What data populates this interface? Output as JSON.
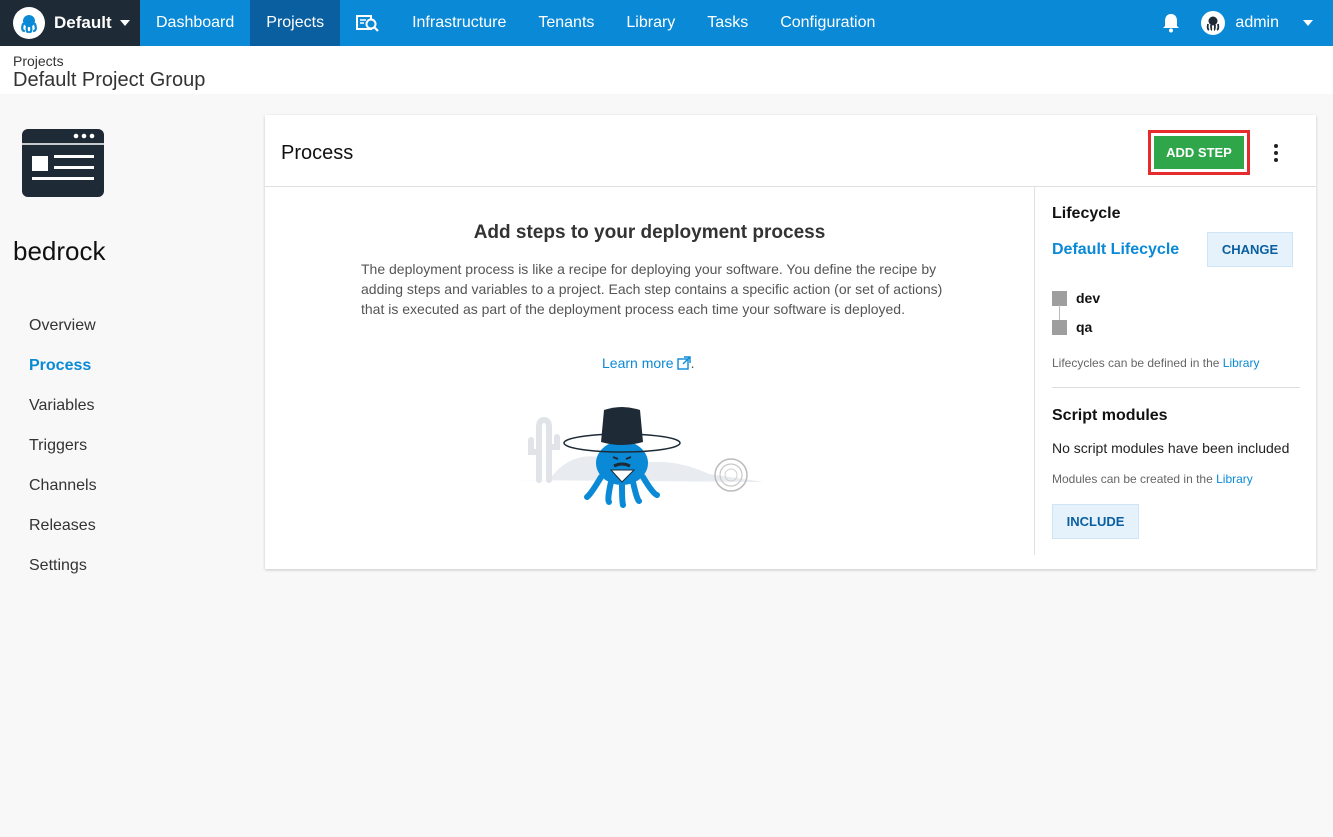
{
  "topnav": {
    "space_name": "Default",
    "items": [
      "Dashboard",
      "Projects",
      "Infrastructure",
      "Tenants",
      "Library",
      "Tasks",
      "Configuration"
    ],
    "active": "Projects",
    "user": "admin",
    "colors": {
      "nav": "#0a8ad6",
      "active": "#0a5fa0",
      "space": "#1e2a36"
    },
    "icons": [
      "octopus-logo-icon",
      "search-icon",
      "bell-icon",
      "user-avatar-icon",
      "chevron-down-icon"
    ]
  },
  "header": {
    "breadcrumb": "Projects",
    "group_title": "Default Project Group"
  },
  "sidebar": {
    "project_name": "bedrock",
    "items": [
      {
        "label": "Overview"
      },
      {
        "label": "Process"
      },
      {
        "label": "Variables"
      },
      {
        "label": "Triggers"
      },
      {
        "label": "Channels"
      },
      {
        "label": "Releases"
      },
      {
        "label": "Settings"
      }
    ],
    "active": "Process"
  },
  "process": {
    "title": "Process",
    "add_step_label": "ADD STEP",
    "empty_title": "Add steps to your deployment process",
    "empty_text": "The deployment process is like a recipe for deploying your software. You define the recipe by adding steps and variables to a project. Each step contains a specific action (or set of actions) that is executed as part of the deployment process each time your software is deployed.",
    "learn_more": "Learn more",
    "add_step_color": "#30a64a"
  },
  "lifecycle": {
    "label": "Lifecycle",
    "name": "Default Lifecycle",
    "change_label": "CHANGE",
    "phases": [
      "dev",
      "qa"
    ],
    "note_text": "Lifecycles can be defined in the",
    "note_link": "Library"
  },
  "script_modules": {
    "label": "Script modules",
    "empty_text": "No script modules have been included",
    "note_text": "Modules can be created in the",
    "note_link": "Library",
    "include_label": "INCLUDE"
  }
}
